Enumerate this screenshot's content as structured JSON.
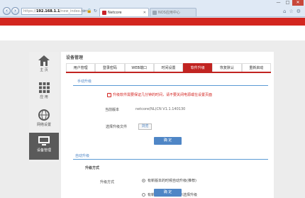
{
  "browser": {
    "address": {
      "protocol": "https://",
      "host": "192.168.1.1",
      "path": "/new_index.htm"
    },
    "tabs": [
      {
        "label": "Netcore",
        "active": true
      },
      {
        "label": "NOS应用中心",
        "active": false
      }
    ],
    "window_controls": {
      "minimize": "—",
      "maximize": "□",
      "close": "✕"
    }
  },
  "sidebar": {
    "items": [
      {
        "label": "主 页",
        "icon": "home-icon"
      },
      {
        "label": "应 用",
        "icon": "apps-grid-icon"
      },
      {
        "label": "网络设置",
        "icon": "globe-icon"
      },
      {
        "label": "设备管理",
        "icon": "monitor-icon",
        "active": true
      }
    ]
  },
  "main": {
    "title": "设备管理",
    "tabs": [
      {
        "label": "用户管理"
      },
      {
        "label": "登录密码"
      },
      {
        "label": "WEB端口"
      },
      {
        "label": "时间设置"
      },
      {
        "label": "软件升级",
        "active": true
      },
      {
        "label": "恢复默认"
      },
      {
        "label": "重新启动"
      }
    ],
    "manual": {
      "title": "手动升级",
      "warning": "升级软件需要保证几分钟的时间，请不要关闭电源或在设置页面",
      "version_label": "当前版本",
      "version_value": "netcore(NL)CN V1.1.140130",
      "file_label": "选择升级文件",
      "browse_label": "浏览",
      "confirm_label": "确 定"
    },
    "auto": {
      "title": "自动升级",
      "mode_title": "升级方式",
      "mode_label": "升级方式",
      "option1": "有新版本的时候自动升级(推荐)",
      "option2": "有新版本时，弹窗提示选择升级",
      "confirm_label": "确 定"
    }
  },
  "colors": {
    "brand_red": "#d3261f",
    "accent_blue": "#4f86c6",
    "warning_red": "#d32420"
  }
}
